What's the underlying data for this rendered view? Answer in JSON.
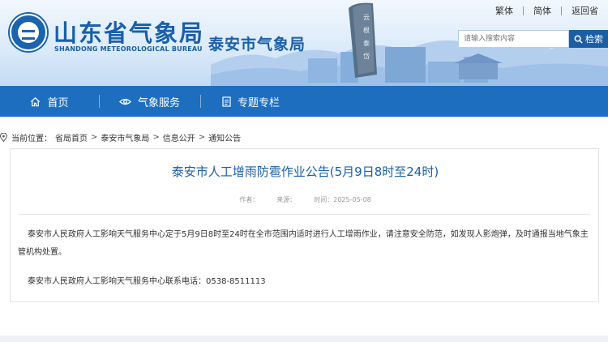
{
  "header": {
    "site_title": "山东省气象局",
    "site_title_en": "SHANDONG METEOROLOGICAL BUREAU",
    "city_title": "泰安市气象局",
    "top_links": [
      "繁体",
      "简体",
      "返回省"
    ],
    "search_placeholder": "请输入搜索内容",
    "search_button": "检索"
  },
  "nav": {
    "items": [
      {
        "label": "首页",
        "icon": "home-icon"
      },
      {
        "label": "气象服务",
        "icon": "eye-icon"
      },
      {
        "label": "专题专栏",
        "icon": "document-icon"
      }
    ]
  },
  "breadcrumb": {
    "prefix": "当前位置：",
    "items": [
      "省局首页",
      "泰安市气象局",
      "信息公开",
      "通知公告"
    ]
  },
  "article": {
    "title": "泰安市人工增雨防雹作业公告(5月9日8时至24时)",
    "author_label": "作者：",
    "source_label": "来源：",
    "time_label": "时间：",
    "date": "2025-05-08",
    "paragraph1": "泰安市人民政府人工影响天气服务中心定于5月9日8时至24时在全市范围内适时进行人工增雨作业，请注意安全防范，如发现人影炮弹，及时通报当地气象主管机构处置。",
    "paragraph2": "泰安市人民政府人工影响天气服务中心联系电话：0538-8511113"
  },
  "colors": {
    "brand_blue": "#1a5faa",
    "nav_blue": "#1e6ec0"
  }
}
